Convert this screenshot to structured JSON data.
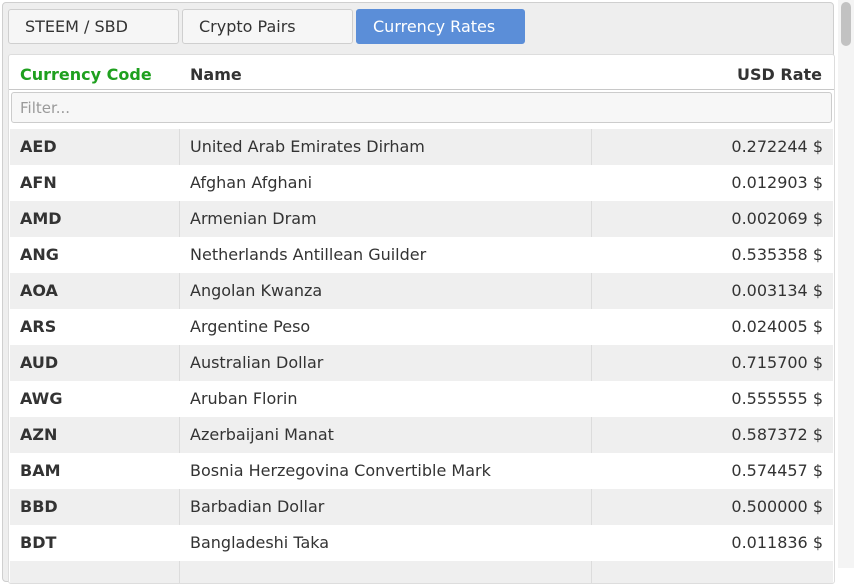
{
  "colors": {
    "active_tab_bg": "#5b8ed8",
    "code_header_color": "#1fa01f"
  },
  "tabs": [
    {
      "label": "STEEM / SBD",
      "active": false
    },
    {
      "label": "Crypto Pairs",
      "active": false
    },
    {
      "label": "Currency Rates",
      "active": true
    }
  ],
  "table": {
    "headers": {
      "code": "Currency Code",
      "name": "Name",
      "rate": "USD Rate"
    },
    "filter_placeholder": "Filter...",
    "rows": [
      {
        "code": "AED",
        "name": "United Arab Emirates Dirham",
        "rate": "0.272244 $"
      },
      {
        "code": "AFN",
        "name": "Afghan Afghani",
        "rate": "0.012903 $"
      },
      {
        "code": "AMD",
        "name": "Armenian Dram",
        "rate": "0.002069 $"
      },
      {
        "code": "ANG",
        "name": "Netherlands Antillean Guilder",
        "rate": "0.535358 $"
      },
      {
        "code": "AOA",
        "name": "Angolan Kwanza",
        "rate": "0.003134 $"
      },
      {
        "code": "ARS",
        "name": "Argentine Peso",
        "rate": "0.024005 $"
      },
      {
        "code": "AUD",
        "name": "Australian Dollar",
        "rate": "0.715700 $"
      },
      {
        "code": "AWG",
        "name": "Aruban Florin",
        "rate": "0.555555 $"
      },
      {
        "code": "AZN",
        "name": "Azerbaijani Manat",
        "rate": "0.587372 $"
      },
      {
        "code": "BAM",
        "name": "Bosnia Herzegovina Convertible Mark",
        "rate": "0.574457 $"
      },
      {
        "code": "BBD",
        "name": "Barbadian Dollar",
        "rate": "0.500000 $"
      },
      {
        "code": "BDT",
        "name": "Bangladeshi Taka",
        "rate": "0.011836 $"
      },
      {
        "code": "",
        "name": "",
        "rate": ""
      }
    ]
  }
}
